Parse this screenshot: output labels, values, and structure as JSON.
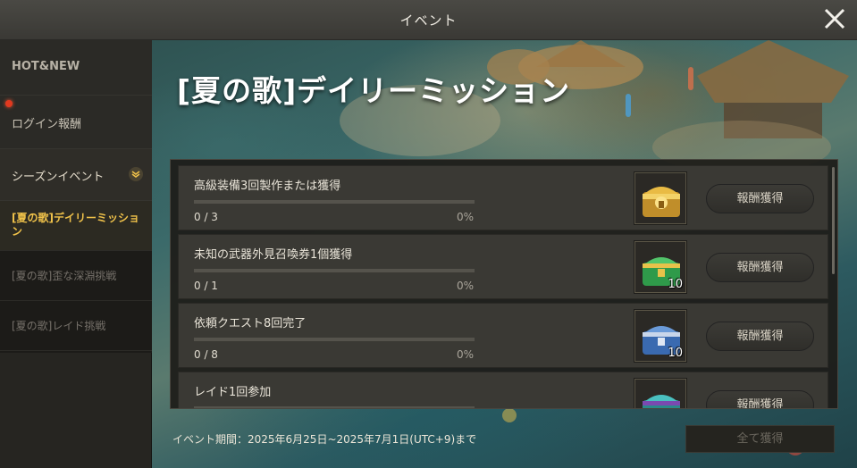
{
  "window": {
    "title": "イベント"
  },
  "sidebar": {
    "hot_new": "HOT&NEW",
    "login_reward": "ログイン報酬",
    "season_event": "シーズンイベント",
    "sub_items": [
      {
        "label": "[夏の歌]デイリーミッション",
        "active": true
      },
      {
        "label": "[夏の歌]歪な深淵挑戦",
        "active": false
      },
      {
        "label": "[夏の歌]レイド挑戦",
        "active": false
      }
    ]
  },
  "main": {
    "heading": "[夏の歌]デイリーミッション",
    "missions": [
      {
        "name": "高級装備3回製作または獲得",
        "count": "0 / 3",
        "percent": "0%",
        "progress": 0,
        "reward_icon": "gold-chest-icon",
        "qty": "",
        "claim": "報酬獲得"
      },
      {
        "name": "未知の武器外見召喚券1個獲得",
        "count": "0 / 1",
        "percent": "0%",
        "progress": 0,
        "reward_icon": "green-chest-icon",
        "qty": "10",
        "claim": "報酬獲得"
      },
      {
        "name": "依頼クエスト8回完了",
        "count": "0 / 8",
        "percent": "0%",
        "progress": 0,
        "reward_icon": "blue-chest-icon",
        "qty": "10",
        "claim": "報酬獲得"
      },
      {
        "name": "レイド1回参加",
        "count": "",
        "percent": "",
        "progress": 0,
        "reward_icon": "teal-chest-icon",
        "qty": "",
        "claim": "報酬獲得"
      }
    ]
  },
  "footer": {
    "period": "イベント期間：2025年6月25日~2025年7月1日(UTC+9)まで",
    "claim_all": "全て獲得"
  },
  "colors": {
    "accent": "#f0c24a",
    "notification": "#e2391f"
  }
}
